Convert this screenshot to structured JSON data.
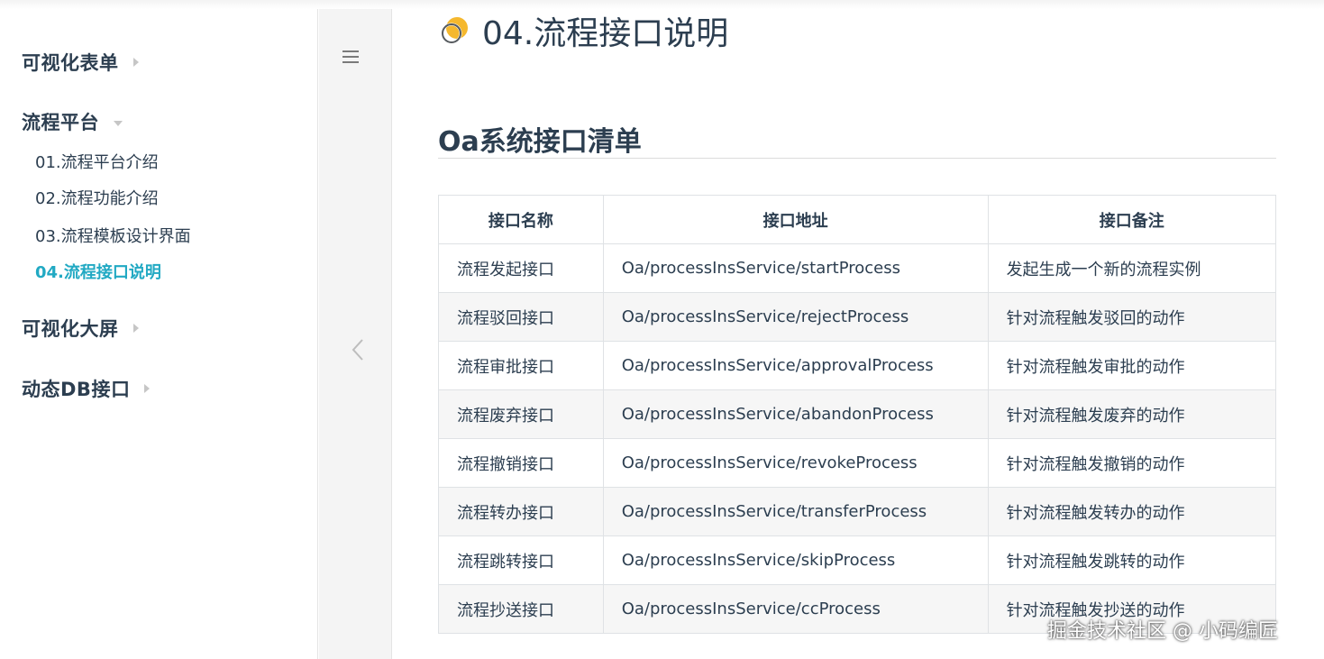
{
  "sidebar": {
    "groups": [
      {
        "label": "可视化表单"
      },
      {
        "label": "流程平台"
      },
      {
        "label": "可视化大屏"
      },
      {
        "label": "动态DB接口"
      }
    ],
    "sub_items": [
      {
        "label": "01.流程平台介绍"
      },
      {
        "label": "02.流程功能介绍"
      },
      {
        "label": "03.流程模板设计界面"
      },
      {
        "label": "04.流程接口说明"
      }
    ]
  },
  "page": {
    "title": "04.流程接口说明",
    "section_heading": "Oa系统接口清单"
  },
  "table": {
    "headers": [
      "接口名称",
      "接口地址",
      "接口备注"
    ],
    "rows": [
      [
        "流程发起接口",
        "Oa/processInsService/startProcess",
        "发起生成一个新的流程实例"
      ],
      [
        "流程驳回接口",
        "Oa/processInsService/rejectProcess",
        "针对流程触发驳回的动作"
      ],
      [
        "流程审批接口",
        "Oa/processInsService/approvalProcess",
        "针对流程触发审批的动作"
      ],
      [
        "流程废弃接口",
        "Oa/processInsService/abandonProcess",
        "针对流程触发废弃的动作"
      ],
      [
        "流程撤销接口",
        "Oa/processInsService/revokeProcess",
        "针对流程触发撤销的动作"
      ],
      [
        "流程转办接口",
        "Oa/processInsService/transferProcess",
        "针对流程触发转办的动作"
      ],
      [
        "流程跳转接口",
        "Oa/processInsService/skipProcess",
        "针对流程触发跳转的动作"
      ],
      [
        "流程抄送接口",
        "Oa/processInsService/ccProcess",
        "针对流程触发抄送的动作"
      ]
    ]
  },
  "watermark": "掘金技术社区 @ 小码编匠",
  "colors": {
    "accent": "#21a9c3",
    "text": "#2c3e50",
    "icon_yellow": "#f5b82e"
  },
  "icons": [
    "menu-icon",
    "chevron-left-icon",
    "title-bullet-icon"
  ]
}
